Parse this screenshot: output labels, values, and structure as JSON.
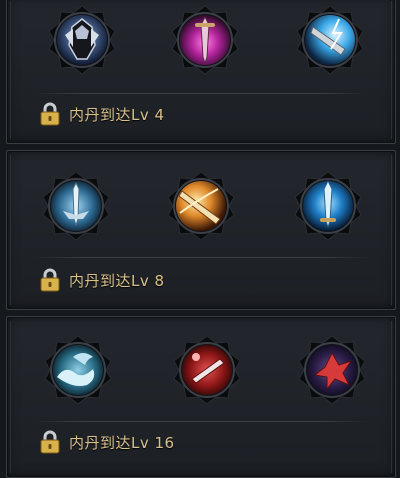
{
  "tiers": [
    {
      "unlock": {
        "label": "内丹到达Lv 4",
        "level": 4
      },
      "skills": [
        {
          "icon": "dark-armor-icon"
        },
        {
          "icon": "magenta-sword-icon"
        },
        {
          "icon": "lightning-blade-icon"
        }
      ]
    },
    {
      "unlock": {
        "label": "内丹到达Lv 8",
        "level": 8
      },
      "skills": [
        {
          "icon": "ice-sword-icon"
        },
        {
          "icon": "flame-blade-icon"
        },
        {
          "icon": "blue-sword-icon"
        }
      ]
    },
    {
      "unlock": {
        "label": "内丹到达Lv 16",
        "level": 16
      },
      "skills": [
        {
          "icon": "dragon-wave-icon"
        },
        {
          "icon": "red-dagger-icon"
        },
        {
          "icon": "crimson-phoenix-icon"
        }
      ]
    }
  ],
  "colors": {
    "unlock_text": "#d9c08a",
    "frame": "#0a0b0d",
    "panel": "#1c1f24"
  }
}
